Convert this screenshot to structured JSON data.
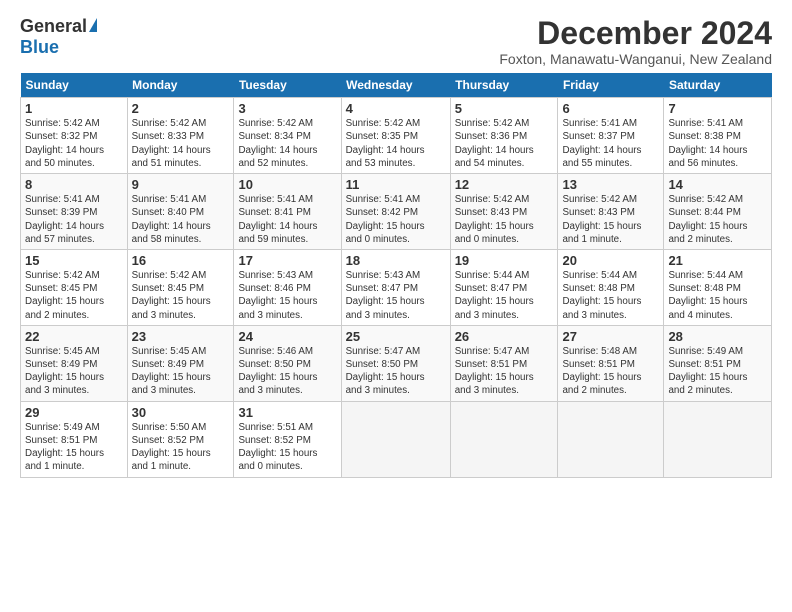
{
  "logo": {
    "general": "General",
    "blue": "Blue"
  },
  "title": "December 2024",
  "subtitle": "Foxton, Manawatu-Wanganui, New Zealand",
  "weekdays": [
    "Sunday",
    "Monday",
    "Tuesday",
    "Wednesday",
    "Thursday",
    "Friday",
    "Saturday"
  ],
  "weeks": [
    [
      {
        "day": "1",
        "detail": "Sunrise: 5:42 AM\nSunset: 8:32 PM\nDaylight: 14 hours\nand 50 minutes."
      },
      {
        "day": "2",
        "detail": "Sunrise: 5:42 AM\nSunset: 8:33 PM\nDaylight: 14 hours\nand 51 minutes."
      },
      {
        "day": "3",
        "detail": "Sunrise: 5:42 AM\nSunset: 8:34 PM\nDaylight: 14 hours\nand 52 minutes."
      },
      {
        "day": "4",
        "detail": "Sunrise: 5:42 AM\nSunset: 8:35 PM\nDaylight: 14 hours\nand 53 minutes."
      },
      {
        "day": "5",
        "detail": "Sunrise: 5:42 AM\nSunset: 8:36 PM\nDaylight: 14 hours\nand 54 minutes."
      },
      {
        "day": "6",
        "detail": "Sunrise: 5:41 AM\nSunset: 8:37 PM\nDaylight: 14 hours\nand 55 minutes."
      },
      {
        "day": "7",
        "detail": "Sunrise: 5:41 AM\nSunset: 8:38 PM\nDaylight: 14 hours\nand 56 minutes."
      }
    ],
    [
      {
        "day": "8",
        "detail": "Sunrise: 5:41 AM\nSunset: 8:39 PM\nDaylight: 14 hours\nand 57 minutes."
      },
      {
        "day": "9",
        "detail": "Sunrise: 5:41 AM\nSunset: 8:40 PM\nDaylight: 14 hours\nand 58 minutes."
      },
      {
        "day": "10",
        "detail": "Sunrise: 5:41 AM\nSunset: 8:41 PM\nDaylight: 14 hours\nand 59 minutes."
      },
      {
        "day": "11",
        "detail": "Sunrise: 5:41 AM\nSunset: 8:42 PM\nDaylight: 15 hours\nand 0 minutes."
      },
      {
        "day": "12",
        "detail": "Sunrise: 5:42 AM\nSunset: 8:43 PM\nDaylight: 15 hours\nand 0 minutes."
      },
      {
        "day": "13",
        "detail": "Sunrise: 5:42 AM\nSunset: 8:43 PM\nDaylight: 15 hours\nand 1 minute."
      },
      {
        "day": "14",
        "detail": "Sunrise: 5:42 AM\nSunset: 8:44 PM\nDaylight: 15 hours\nand 2 minutes."
      }
    ],
    [
      {
        "day": "15",
        "detail": "Sunrise: 5:42 AM\nSunset: 8:45 PM\nDaylight: 15 hours\nand 2 minutes."
      },
      {
        "day": "16",
        "detail": "Sunrise: 5:42 AM\nSunset: 8:45 PM\nDaylight: 15 hours\nand 3 minutes."
      },
      {
        "day": "17",
        "detail": "Sunrise: 5:43 AM\nSunset: 8:46 PM\nDaylight: 15 hours\nand 3 minutes."
      },
      {
        "day": "18",
        "detail": "Sunrise: 5:43 AM\nSunset: 8:47 PM\nDaylight: 15 hours\nand 3 minutes."
      },
      {
        "day": "19",
        "detail": "Sunrise: 5:44 AM\nSunset: 8:47 PM\nDaylight: 15 hours\nand 3 minutes."
      },
      {
        "day": "20",
        "detail": "Sunrise: 5:44 AM\nSunset: 8:48 PM\nDaylight: 15 hours\nand 3 minutes."
      },
      {
        "day": "21",
        "detail": "Sunrise: 5:44 AM\nSunset: 8:48 PM\nDaylight: 15 hours\nand 4 minutes."
      }
    ],
    [
      {
        "day": "22",
        "detail": "Sunrise: 5:45 AM\nSunset: 8:49 PM\nDaylight: 15 hours\nand 3 minutes."
      },
      {
        "day": "23",
        "detail": "Sunrise: 5:45 AM\nSunset: 8:49 PM\nDaylight: 15 hours\nand 3 minutes."
      },
      {
        "day": "24",
        "detail": "Sunrise: 5:46 AM\nSunset: 8:50 PM\nDaylight: 15 hours\nand 3 minutes."
      },
      {
        "day": "25",
        "detail": "Sunrise: 5:47 AM\nSunset: 8:50 PM\nDaylight: 15 hours\nand 3 minutes."
      },
      {
        "day": "26",
        "detail": "Sunrise: 5:47 AM\nSunset: 8:51 PM\nDaylight: 15 hours\nand 3 minutes."
      },
      {
        "day": "27",
        "detail": "Sunrise: 5:48 AM\nSunset: 8:51 PM\nDaylight: 15 hours\nand 2 minutes."
      },
      {
        "day": "28",
        "detail": "Sunrise: 5:49 AM\nSunset: 8:51 PM\nDaylight: 15 hours\nand 2 minutes."
      }
    ],
    [
      {
        "day": "29",
        "detail": "Sunrise: 5:49 AM\nSunset: 8:51 PM\nDaylight: 15 hours\nand 1 minute."
      },
      {
        "day": "30",
        "detail": "Sunrise: 5:50 AM\nSunset: 8:52 PM\nDaylight: 15 hours\nand 1 minute."
      },
      {
        "day": "31",
        "detail": "Sunrise: 5:51 AM\nSunset: 8:52 PM\nDaylight: 15 hours\nand 0 minutes."
      },
      {
        "day": "",
        "detail": ""
      },
      {
        "day": "",
        "detail": ""
      },
      {
        "day": "",
        "detail": ""
      },
      {
        "day": "",
        "detail": ""
      }
    ]
  ]
}
